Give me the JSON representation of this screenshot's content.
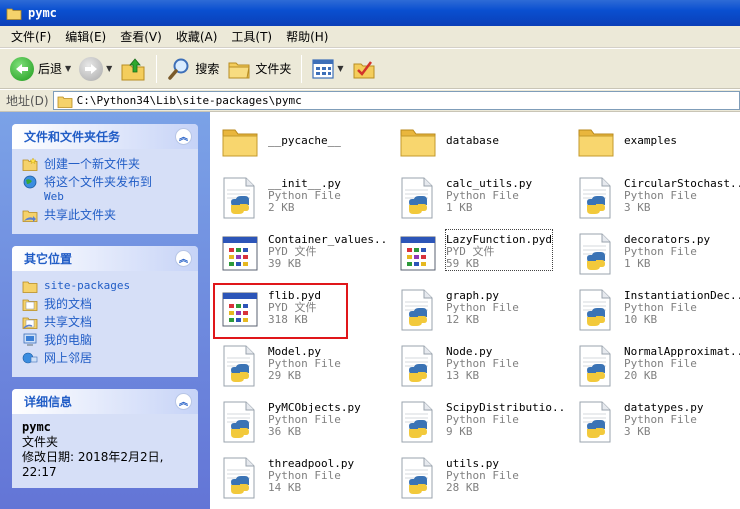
{
  "window": {
    "title": "pymc"
  },
  "menu": [
    "文件(F)",
    "编辑(E)",
    "查看(V)",
    "收藏(A)",
    "工具(T)",
    "帮助(H)"
  ],
  "toolbar": {
    "back": "后退",
    "search": "搜索",
    "folders": "文件夹"
  },
  "address": {
    "label": "地址(D)",
    "path": "C:\\Python34\\Lib\\site-packages\\pymc"
  },
  "panels": {
    "tasks": {
      "title": "文件和文件夹任务",
      "items": [
        {
          "label": "创建一个新文件夹",
          "icon": "new-folder-icon"
        },
        {
          "label": "将这个文件夹发布到",
          "label2": "Web",
          "icon": "publish-web-icon"
        },
        {
          "label": "共享此文件夹",
          "icon": "share-folder-icon"
        }
      ]
    },
    "places": {
      "title": "其它位置",
      "items": [
        {
          "label": "site-packages",
          "icon": "folder-icon"
        },
        {
          "label": "我的文档",
          "icon": "my-documents-icon"
        },
        {
          "label": "共享文档",
          "icon": "shared-documents-icon"
        },
        {
          "label": "我的电脑",
          "icon": "my-computer-icon"
        },
        {
          "label": "网上邻居",
          "icon": "network-icon"
        }
      ]
    },
    "details": {
      "title": "详细信息",
      "name": "pymc",
      "type": "文件夹",
      "modified_label": "修改日期: 2018年2月2日,",
      "modified_time": "22:17"
    }
  },
  "files": [
    {
      "name": "__pycache__",
      "kind": "folder",
      "type": "",
      "size": ""
    },
    {
      "name": "database",
      "kind": "folder",
      "type": "",
      "size": ""
    },
    {
      "name": "examples",
      "kind": "folder",
      "type": "",
      "size": ""
    },
    {
      "name": "__init__.py",
      "kind": "python",
      "type": "Python File",
      "size": "2 KB"
    },
    {
      "name": "calc_utils.py",
      "kind": "python",
      "type": "Python File",
      "size": "1 KB"
    },
    {
      "name": "CircularStochast...",
      "kind": "python",
      "type": "Python File",
      "size": "3 KB"
    },
    {
      "name": "Container_values...",
      "kind": "pyd",
      "type": "PYD 文件",
      "size": "39 KB"
    },
    {
      "name": "LazyFunction.pyd",
      "kind": "pyd",
      "type": "PYD 文件",
      "size": "59 KB"
    },
    {
      "name": "decorators.py",
      "kind": "python",
      "type": "Python File",
      "size": "1 KB"
    },
    {
      "name": "flib.pyd",
      "kind": "pyd",
      "type": "PYD 文件",
      "size": "318 KB"
    },
    {
      "name": "graph.py",
      "kind": "python",
      "type": "Python File",
      "size": "12 KB"
    },
    {
      "name": "InstantiationDec...",
      "kind": "python",
      "type": "Python File",
      "size": "10 KB"
    },
    {
      "name": "Model.py",
      "kind": "python",
      "type": "Python File",
      "size": "29 KB"
    },
    {
      "name": "Node.py",
      "kind": "python",
      "type": "Python File",
      "size": "13 KB"
    },
    {
      "name": "NormalApproximat...",
      "kind": "python",
      "type": "Python File",
      "size": "20 KB"
    },
    {
      "name": "PyMCObjects.py",
      "kind": "python",
      "type": "Python File",
      "size": "36 KB"
    },
    {
      "name": "ScipyDistributio...",
      "kind": "python",
      "type": "Python File",
      "size": "9 KB"
    },
    {
      "name": "datatypes.py",
      "kind": "python",
      "type": "Python File",
      "size": "3 KB"
    },
    {
      "name": "threadpool.py",
      "kind": "python",
      "type": "Python File",
      "size": "14 KB"
    },
    {
      "name": "utils.py",
      "kind": "python",
      "type": "Python File",
      "size": "28 KB"
    }
  ],
  "colors": {
    "titlebar": "#0a4fd0",
    "taskpane": "#6375d6",
    "link": "#215dc6",
    "highlight": "#e0161a"
  }
}
